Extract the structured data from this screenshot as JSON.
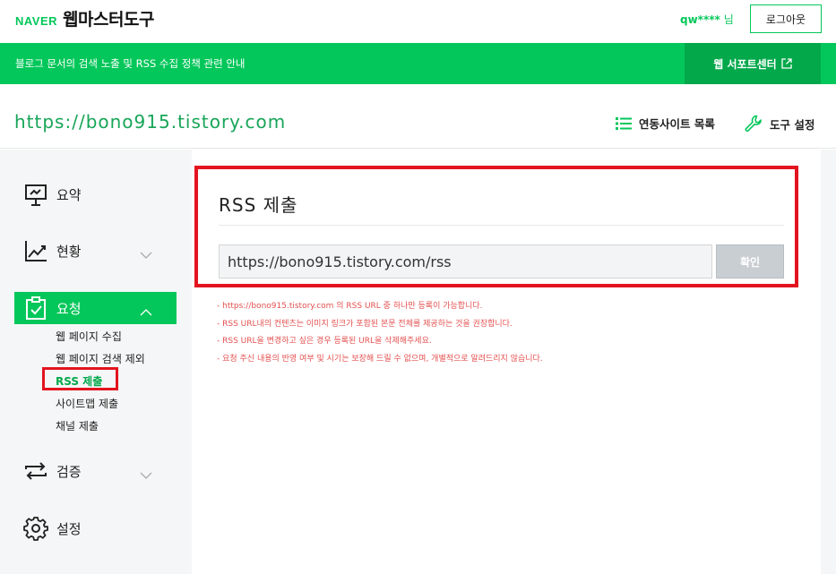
{
  "header": {
    "logo_naver": "NAVER",
    "logo_title": "웹마스터도구",
    "user_name": "qw****",
    "user_suffix": "님",
    "logout_label": "로그아웃"
  },
  "notice": {
    "text": "블로그 문서의 검색 노출 및 RSS 수집 정책 관련 안내",
    "support_label": "웹 서포트센터"
  },
  "site": {
    "url": "https://bono915.tistory.com",
    "linked_sites_label": "연동사이트 목록",
    "tool_settings_label": "도구 설정"
  },
  "sidebar": {
    "items": [
      {
        "label": "요약",
        "icon": "presentation-board-icon"
      },
      {
        "label": "현황",
        "icon": "line-chart-icon"
      },
      {
        "label": "요청",
        "icon": "clipboard-check-icon"
      },
      {
        "label": "검증",
        "icon": "refresh-arrows-icon"
      },
      {
        "label": "설정",
        "icon": "gear-icon"
      }
    ],
    "sub_items": [
      "웹 페이지 수집",
      "웹 페이지 검색 제외",
      "RSS 제출",
      "사이트맵 제출",
      "채널 제출"
    ]
  },
  "rss": {
    "title": "RSS 제출",
    "input_value": "https://bono915.tistory.com/rss",
    "confirm_label": "확인",
    "notes": [
      "- https://bono915.tistory.com 의 RSS URL 중 하나만 등록이 가능합니다.",
      "- RSS URL내의 컨텐츠는 이미지 링크가 포함된 본문 전체를 제공하는 것을 권장합니다.",
      "- RSS URL을 변경하고 싶은 경우 등록된 URL을 삭제해주세요.",
      "- 요청 주신 내용의 반영 여부 및 시기는 보장해 드릴 수 없으며, 개별적으로 알려드리지 않습니다."
    ]
  },
  "colors": {
    "brand_green": "#03c75a",
    "highlight_red": "#e3141f",
    "note_red": "#e55050"
  }
}
